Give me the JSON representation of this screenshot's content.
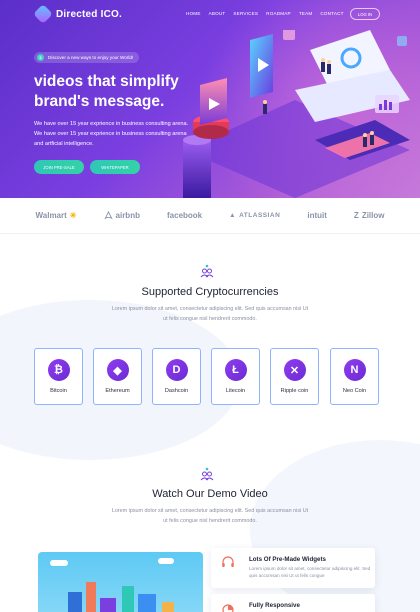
{
  "header": {
    "brand": "Directed ICO.",
    "nav": [
      "HOME",
      "ABOUT",
      "SERVICES",
      "ROADMAP",
      "TEAM",
      "CONTACT"
    ],
    "login": "LOG IN"
  },
  "hero": {
    "announcement": "Discover a new ways to enjoy your World!",
    "title": "videos that simplify brand's message.",
    "description": "We have over 15 year exprience in business consulting arena. We have over 15 year exprience in business consulting arena and artficial intelligence.",
    "primary_button": "JOIN PRE-SALE",
    "secondary_button": "WHITEPAPER"
  },
  "partners": [
    "Walmart",
    "airbnb",
    "facebook",
    "ATLASSIAN",
    "intuit",
    "Zillow"
  ],
  "crypto": {
    "title": "Supported Cryptocurrencies",
    "subtitle": "Lorem ipsum dolor sit amet, consectetur adipiscing elit. Sed quis accumsan nisi Ut ut felis congue nisl hendrerit commodo.",
    "coins": [
      {
        "name": "Bitcoin",
        "symbol": "₿"
      },
      {
        "name": "Ethereum",
        "symbol": "◆"
      },
      {
        "name": "Dashcoin",
        "symbol": "D"
      },
      {
        "name": "Litecoin",
        "symbol": "Ł"
      },
      {
        "name": "Ripple coin",
        "symbol": "✕"
      },
      {
        "name": "Neo Coin",
        "symbol": "N"
      }
    ]
  },
  "demo": {
    "title": "Watch Our Demo Video",
    "subtitle": "Lorem ipsum dolor sit amet, consectetur adipiscing elit. Sed quis accumsan nisi Ut ut felis congue nisl hendrerit commodo.",
    "features": [
      {
        "title": "Lots Of Pre-Made Widgets",
        "desc": "Lorem ipsum dolor sit amet, consectetur adipiscing elit. Sed quis accumsan nisi Ut ut felis congue"
      },
      {
        "title": "Fully Responsive",
        "desc": ""
      }
    ]
  },
  "colors": {
    "brand_purple": "#7b3fe0",
    "accent_teal": "#2fc7b6",
    "card_border": "#8fb3ff"
  }
}
